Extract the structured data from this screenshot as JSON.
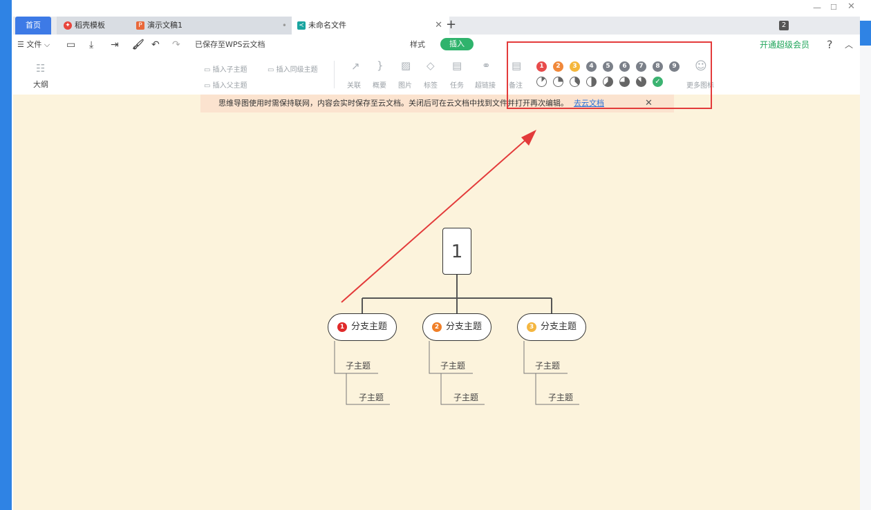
{
  "tabs": {
    "home": "首页",
    "daoke": "稻壳模板",
    "ppt": "演示文稿1",
    "mindmap": "未命名文件",
    "count": "2",
    "add": "+"
  },
  "menu": {
    "file": "文件",
    "saved_status": "已保存至WPS云文档",
    "style": "样式",
    "insert": "插入",
    "vip": "开通超级会员",
    "help": "?"
  },
  "ribbon": {
    "outline": "大纲",
    "insert_child": "插入子主题",
    "insert_sibling": "插入同级主题",
    "insert_parent": "插入父主题",
    "relation": "关联",
    "summary": "概要",
    "image": "图片",
    "tag": "标签",
    "task": "任务",
    "hyperlink": "超链接",
    "note": "备注",
    "more_icons": "更多图标",
    "priority_numbers": [
      "1",
      "2",
      "3",
      "4",
      "5",
      "6",
      "7",
      "8",
      "9"
    ],
    "priority_colors": [
      "#e84b4b",
      "#f0883a",
      "#f5b73b",
      "#7b8089",
      "#7b8089",
      "#7b8089",
      "#7b8089",
      "#7b8089",
      "#7b8089"
    ],
    "progress_levels": [
      0.125,
      0.25,
      0.375,
      0.5,
      0.625,
      0.75,
      0.875,
      1.0
    ]
  },
  "notice": {
    "text": "思维导图使用时需保持联网，内容会实时保存至云文档。关闭后可在云文档中找到文件并打开再次编辑。",
    "link": "去云文档"
  },
  "mindmap": {
    "root": "1",
    "branches": [
      {
        "label": "分支主题",
        "priority": "1",
        "color": "#e02a2a"
      },
      {
        "label": "分支主题",
        "priority": "2",
        "color": "#f07f28"
      },
      {
        "label": "分支主题",
        "priority": "3",
        "color": "#f4b640"
      }
    ],
    "subtopic": "子主题"
  }
}
